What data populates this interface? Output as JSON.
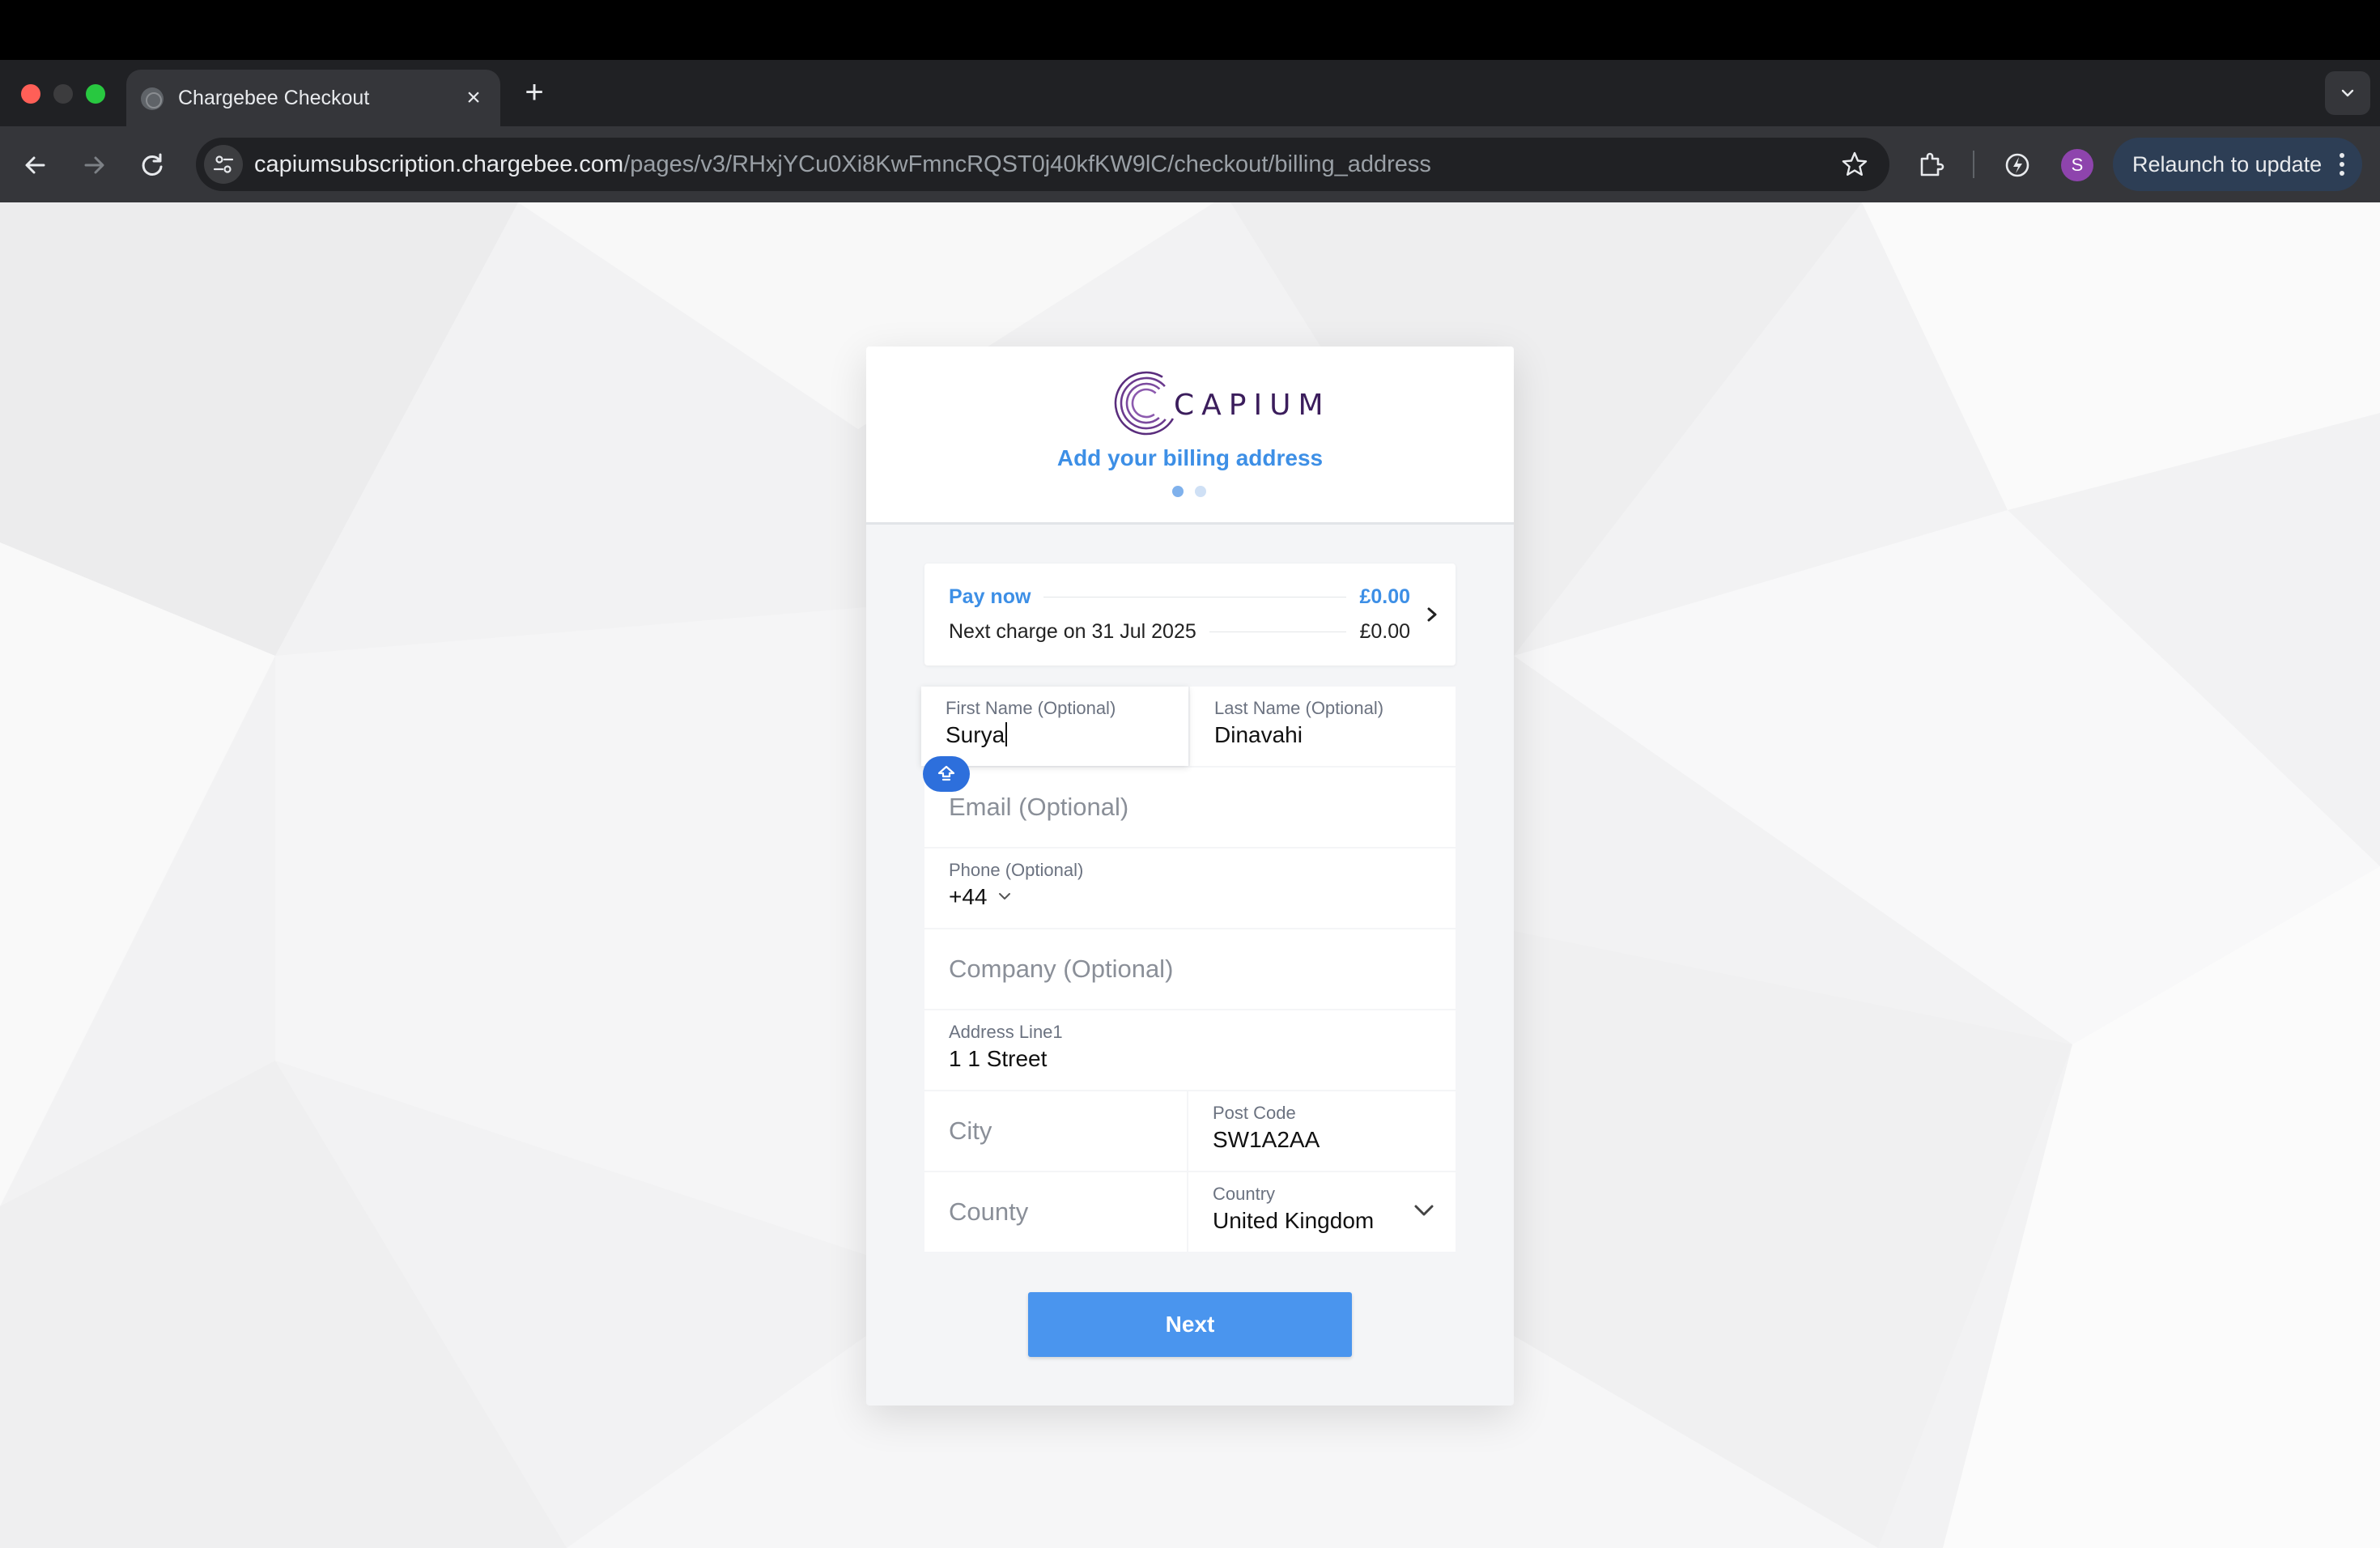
{
  "browser": {
    "tab_title": "Chargebee Checkout",
    "new_tab_symbol": "+",
    "tab_close_symbol": "×",
    "url_host": "capiumsubscription.chargebee.com",
    "url_path": "/pages/v3/RHxjYCu0Xi8KwFmncRQST0j40kfKW9lC/checkout/billing_address",
    "profile_initial": "S",
    "relaunch_label": "Relaunch to update"
  },
  "checkout": {
    "brand": "CAPIUM",
    "title": "Add your billing address",
    "steps_total": 2,
    "current_step": 1,
    "summary": {
      "pay_now_label": "Pay now",
      "pay_now_amount": "£0.00",
      "next_charge_label": "Next charge on 31 Jul 2025",
      "next_charge_amount": "£0.00"
    },
    "fields": {
      "first_name": {
        "label": "First Name (Optional)",
        "value": "Surya"
      },
      "last_name": {
        "label": "Last Name (Optional)",
        "value": "Dinavahi"
      },
      "email": {
        "placeholder": "Email (Optional)"
      },
      "phone": {
        "label": "Phone (Optional)",
        "value": "+44"
      },
      "company": {
        "placeholder": "Company (Optional)"
      },
      "address_line1": {
        "label": "Address Line1",
        "value": "1 1 Street"
      },
      "city": {
        "placeholder": "City"
      },
      "post_code": {
        "label": "Post Code",
        "value": "SW1A2AA"
      },
      "county": {
        "placeholder": "County"
      },
      "country": {
        "label": "Country",
        "value": "United Kingdom"
      }
    },
    "next_button": "Next"
  },
  "colors": {
    "accent": "#3d8fe6",
    "button": "#4a95ee",
    "brand_purple": "#3b1d5c"
  },
  "icons": [
    "back-arrow-icon",
    "forward-arrow-icon",
    "reload-icon",
    "site-settings-icon",
    "bookmark-star-icon",
    "extensions-icon",
    "performance-icon",
    "chevron-right-icon",
    "chevron-down-icon",
    "password-manager-icon"
  ]
}
